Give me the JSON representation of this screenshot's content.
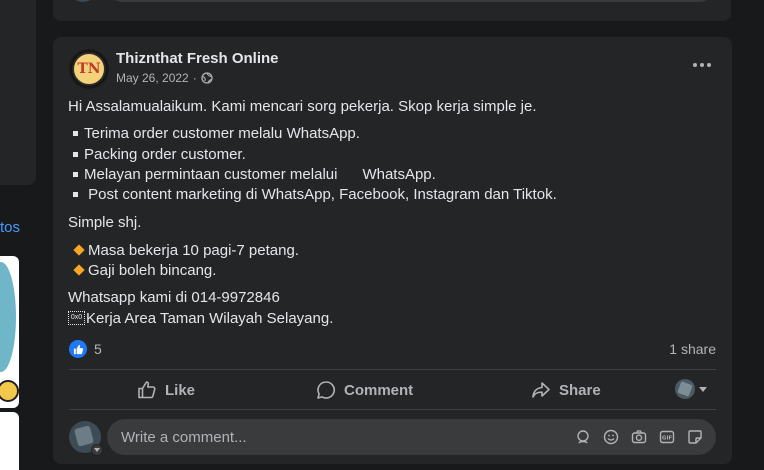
{
  "sidebar": {
    "link_fragment": "tos"
  },
  "post": {
    "author": "Thiznthat Fresh Online",
    "date": "May 26, 2022",
    "dot": "·",
    "avatar_text": "TN",
    "body": {
      "intro": "Hi Assalamualaikum. Kami mencari sorg pekerja. Skop kerja simple je.",
      "duties": [
        "Terima order customer melalu WhatsApp.",
        "Packing order customer.",
        "Melayan permintaan customer melalui      WhatsApp.",
        " Post content marketing di WhatsApp, Facebook, Instagram dan Tiktok."
      ],
      "simple": "Simple shj.",
      "perks": [
        "Masa bekerja 10 pagi-7 petang.",
        "Gaji boleh bincang."
      ],
      "contact": "Whatsapp kami di 014-9972846",
      "area": "Kerja Area Taman Wilayah Selayang.",
      "area_glyph": "0x0"
    },
    "reactions": {
      "count": "5"
    },
    "shares": "1 share",
    "actions": {
      "like": "Like",
      "comment": "Comment",
      "share": "Share"
    },
    "comment_placeholder": "Write a comment..."
  },
  "colors": {
    "page_bg": "#18191a",
    "card_bg": "#242526",
    "input_bg": "#3a3b3c",
    "text_primary": "#e4e6eb",
    "text_secondary": "#b0b3b8",
    "link": "#4599ff",
    "like_blue": "#2078f4",
    "diamond_orange": "#f5a623"
  },
  "icons": [
    "globe-icon",
    "more-icon",
    "like-icon",
    "thumbs-up-icon",
    "comment-icon",
    "share-icon",
    "emoji-icon",
    "camera-icon",
    "gif-icon",
    "sticker-icon",
    "avatar-sticker-icon"
  ]
}
